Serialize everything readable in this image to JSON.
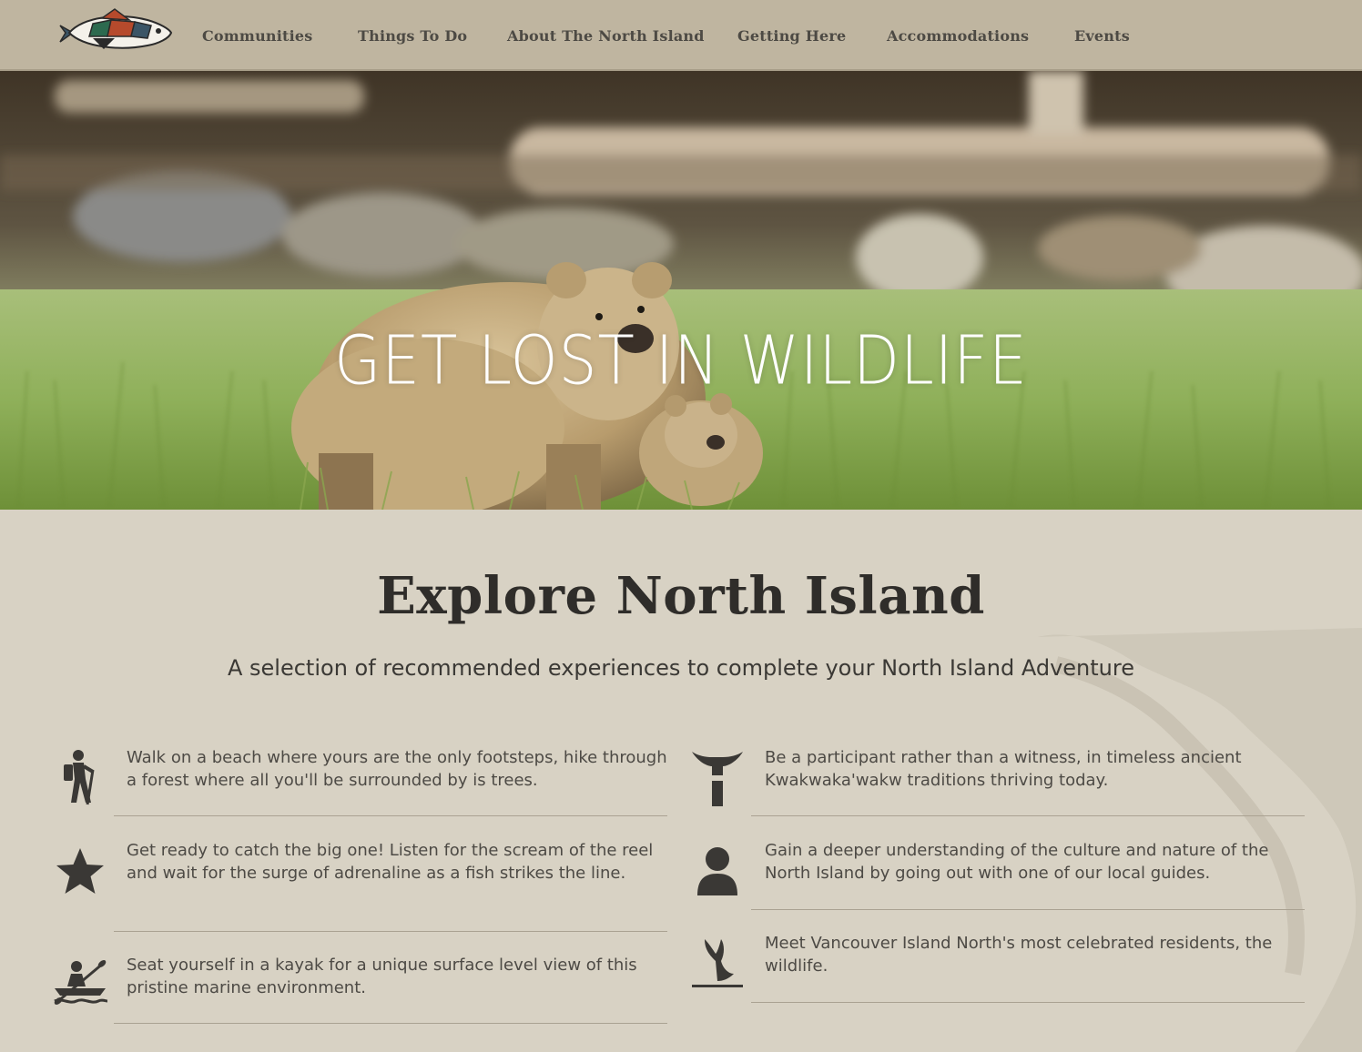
{
  "nav": {
    "items": [
      {
        "label": "Communities"
      },
      {
        "label": "Things To Do"
      },
      {
        "label": "About The North Island"
      },
      {
        "label": "Getting Here"
      },
      {
        "label": "Accommodations"
      },
      {
        "label": "Events"
      }
    ]
  },
  "hero": {
    "title": "GET LOST IN WILDLIFE"
  },
  "section": {
    "title": "Explore North Island",
    "subtitle": "A selection of recommended experiences to complete your North Island Adventure"
  },
  "experiences": [
    {
      "icon": "hiker-icon",
      "text": "Walk on a beach where yours are the only footsteps, hike through a forest where all you'll be surrounded by is trees."
    },
    {
      "icon": "totem-icon",
      "text": "Be a participant rather than a witness, in timeless ancient Kwakwaka'wakw traditions thriving today."
    },
    {
      "icon": "star-icon",
      "text": "Get ready to catch the big one! Listen for the scream of the reel and wait for the surge of adrenaline as a fish strikes the line."
    },
    {
      "icon": "person-icon",
      "text": "Gain a deeper understanding of the culture and nature of the North Island by going out with one of our local guides."
    },
    {
      "icon": "kayak-icon",
      "text": "Seat yourself in a kayak for a unique surface level view of this pristine marine environment."
    },
    {
      "icon": "whale-tail-icon",
      "text": "Meet Vancouver Island North's most celebrated residents, the wildlife."
    }
  ],
  "colors": {
    "nav_bg": "#bfb5a0",
    "content_bg": "#d8d2c4",
    "text_dark": "#2f2d2a",
    "icon": "#3a3835"
  }
}
